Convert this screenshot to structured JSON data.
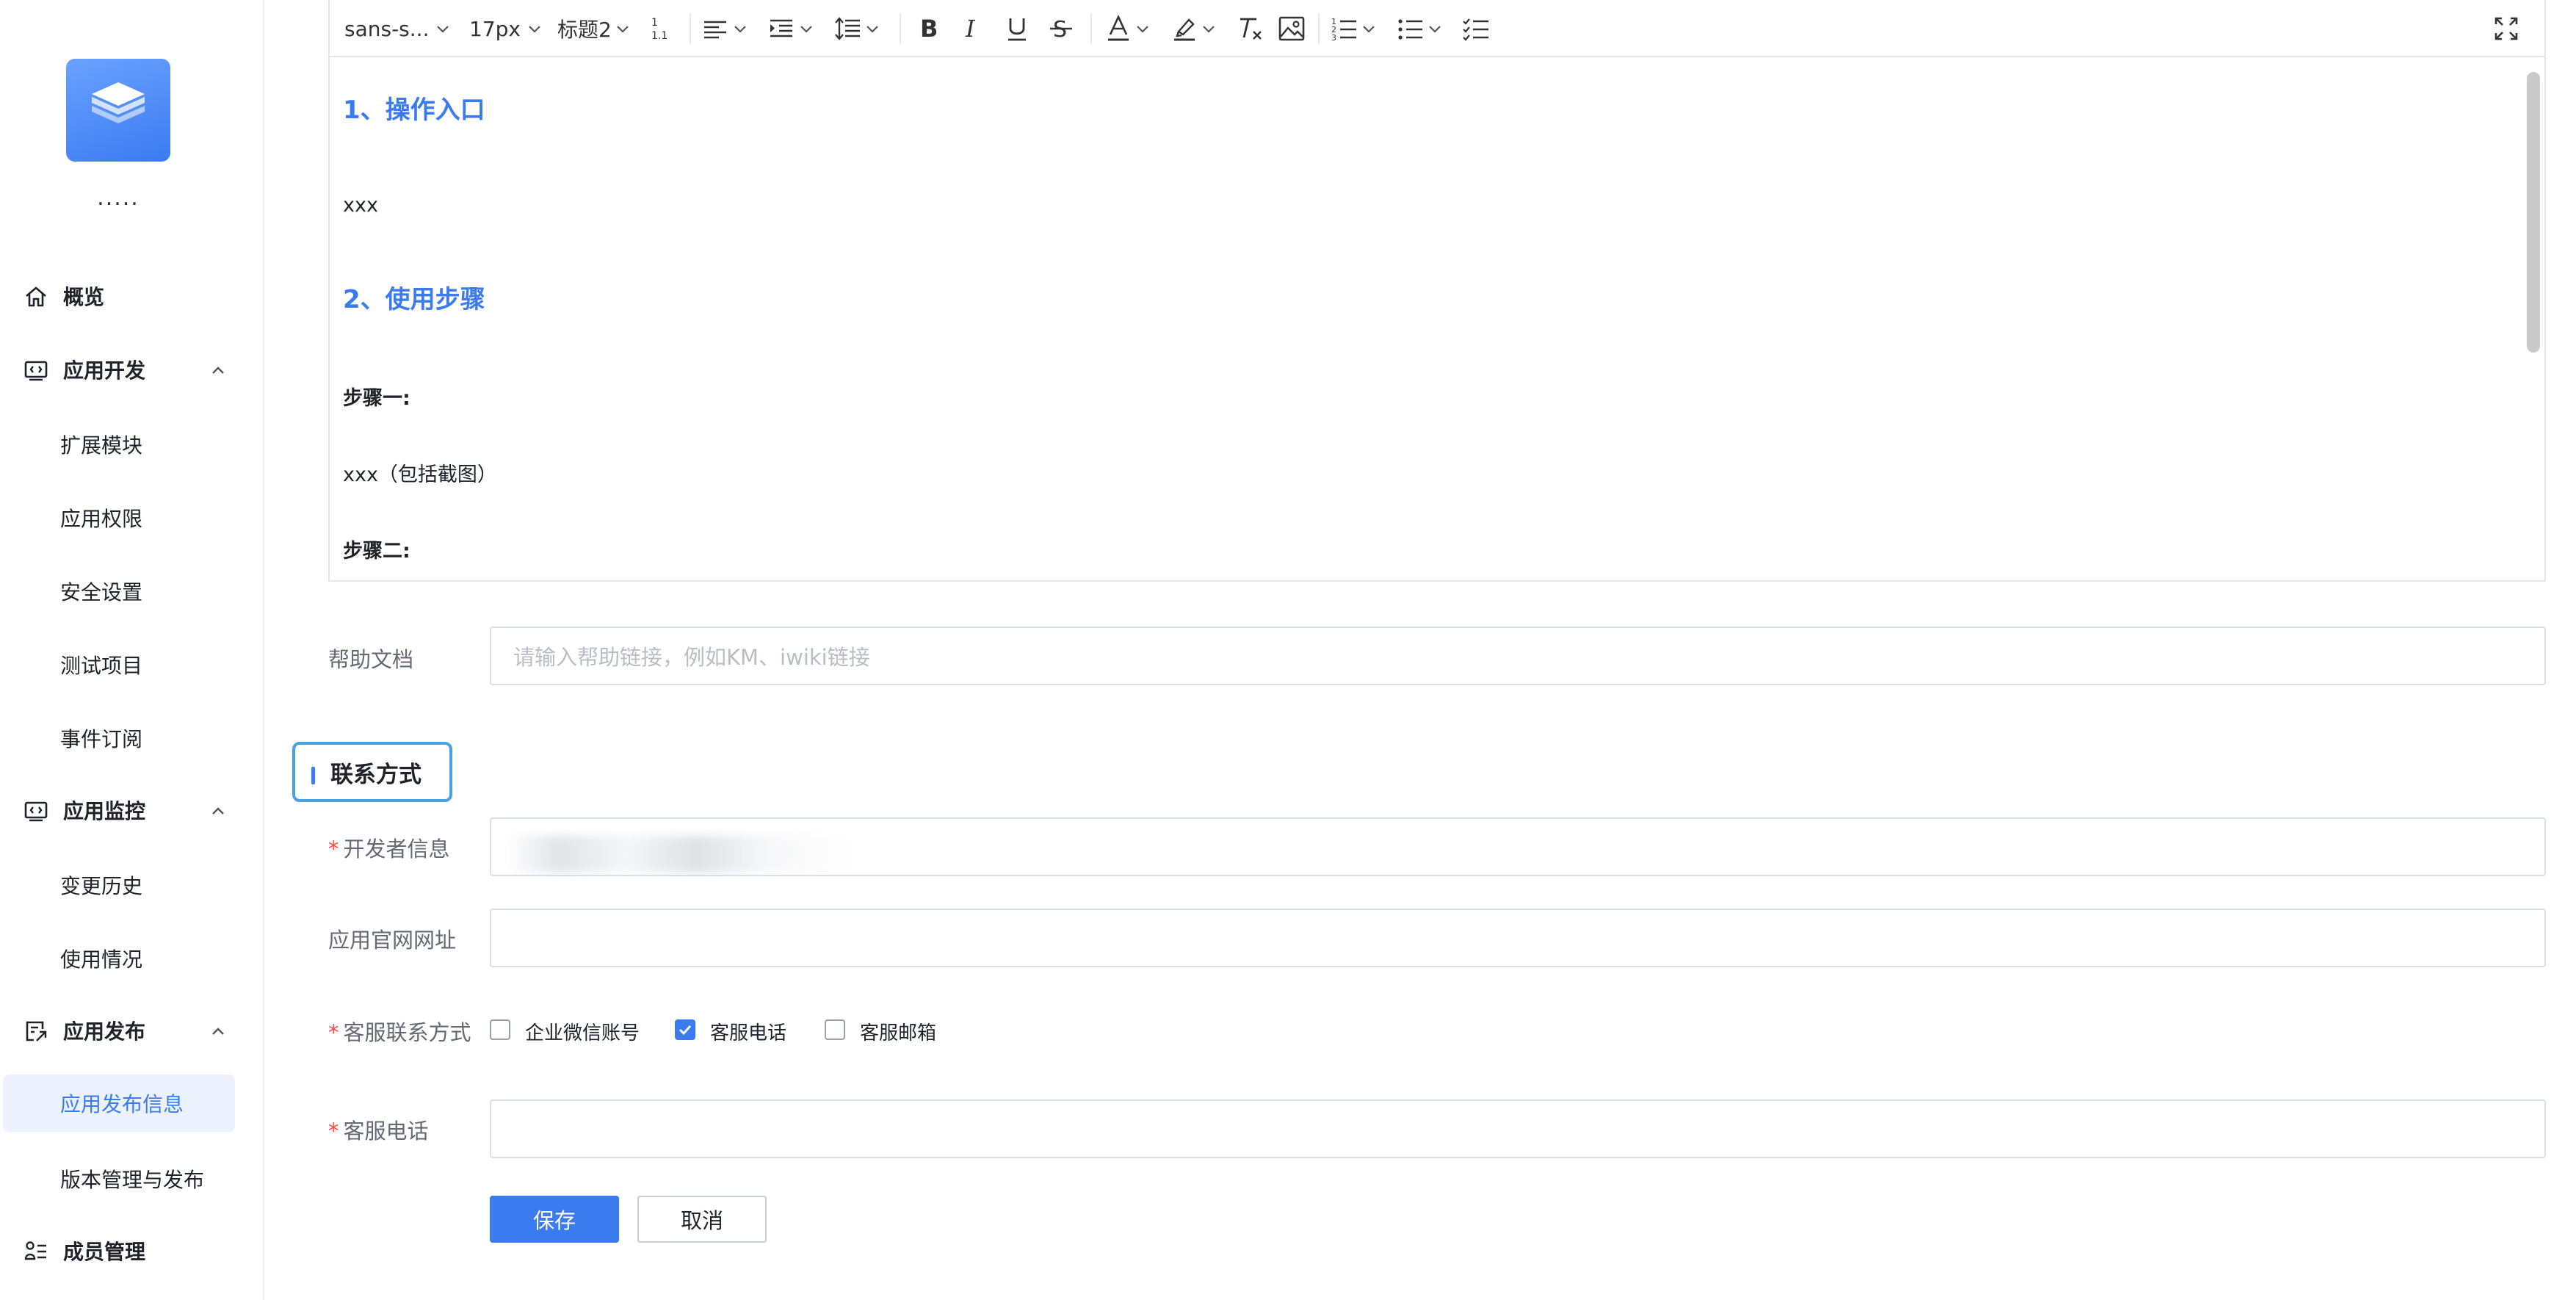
{
  "app": {
    "name": "....."
  },
  "sidebar": {
    "overview": "概览",
    "groups": [
      {
        "label": "应用开发",
        "items": [
          "扩展模块",
          "应用权限",
          "安全设置",
          "测试项目",
          "事件订阅"
        ]
      },
      {
        "label": "应用监控",
        "items": [
          "变更历史",
          "使用情况"
        ]
      },
      {
        "label": "应用发布",
        "items": [
          "应用发布信息",
          "版本管理与发布"
        ]
      }
    ],
    "members": "成员管理",
    "active_item": "应用发布信息"
  },
  "toolbar": {
    "font_family": "sans-s...",
    "font_size": "17px",
    "heading": "标题2"
  },
  "doc": {
    "h1": "1、操作入口",
    "p1": "xxx",
    "h2": "2、使用步骤",
    "step1": "步骤一:",
    "p2": "xxx（包括截图）",
    "step2": "步骤二:"
  },
  "form": {
    "help_doc_label": "帮助文档",
    "help_doc_placeholder": "请输入帮助链接，例如KM、iwiki链接",
    "section_title": "联系方式",
    "developer_label": "开发者信息",
    "website_label": "应用官网网址",
    "contact_label": "客服联系方式",
    "contact_options": [
      {
        "label": "企业微信账号",
        "checked": false
      },
      {
        "label": "客服电话",
        "checked": true
      },
      {
        "label": "客服邮箱",
        "checked": false
      }
    ],
    "phone_label": "客服电话",
    "required_mark": "*",
    "save": "保存",
    "cancel": "取消"
  },
  "colors": {
    "accent": "#3b7bf0",
    "required": "#f54a45",
    "border": "#dcdfe6"
  }
}
